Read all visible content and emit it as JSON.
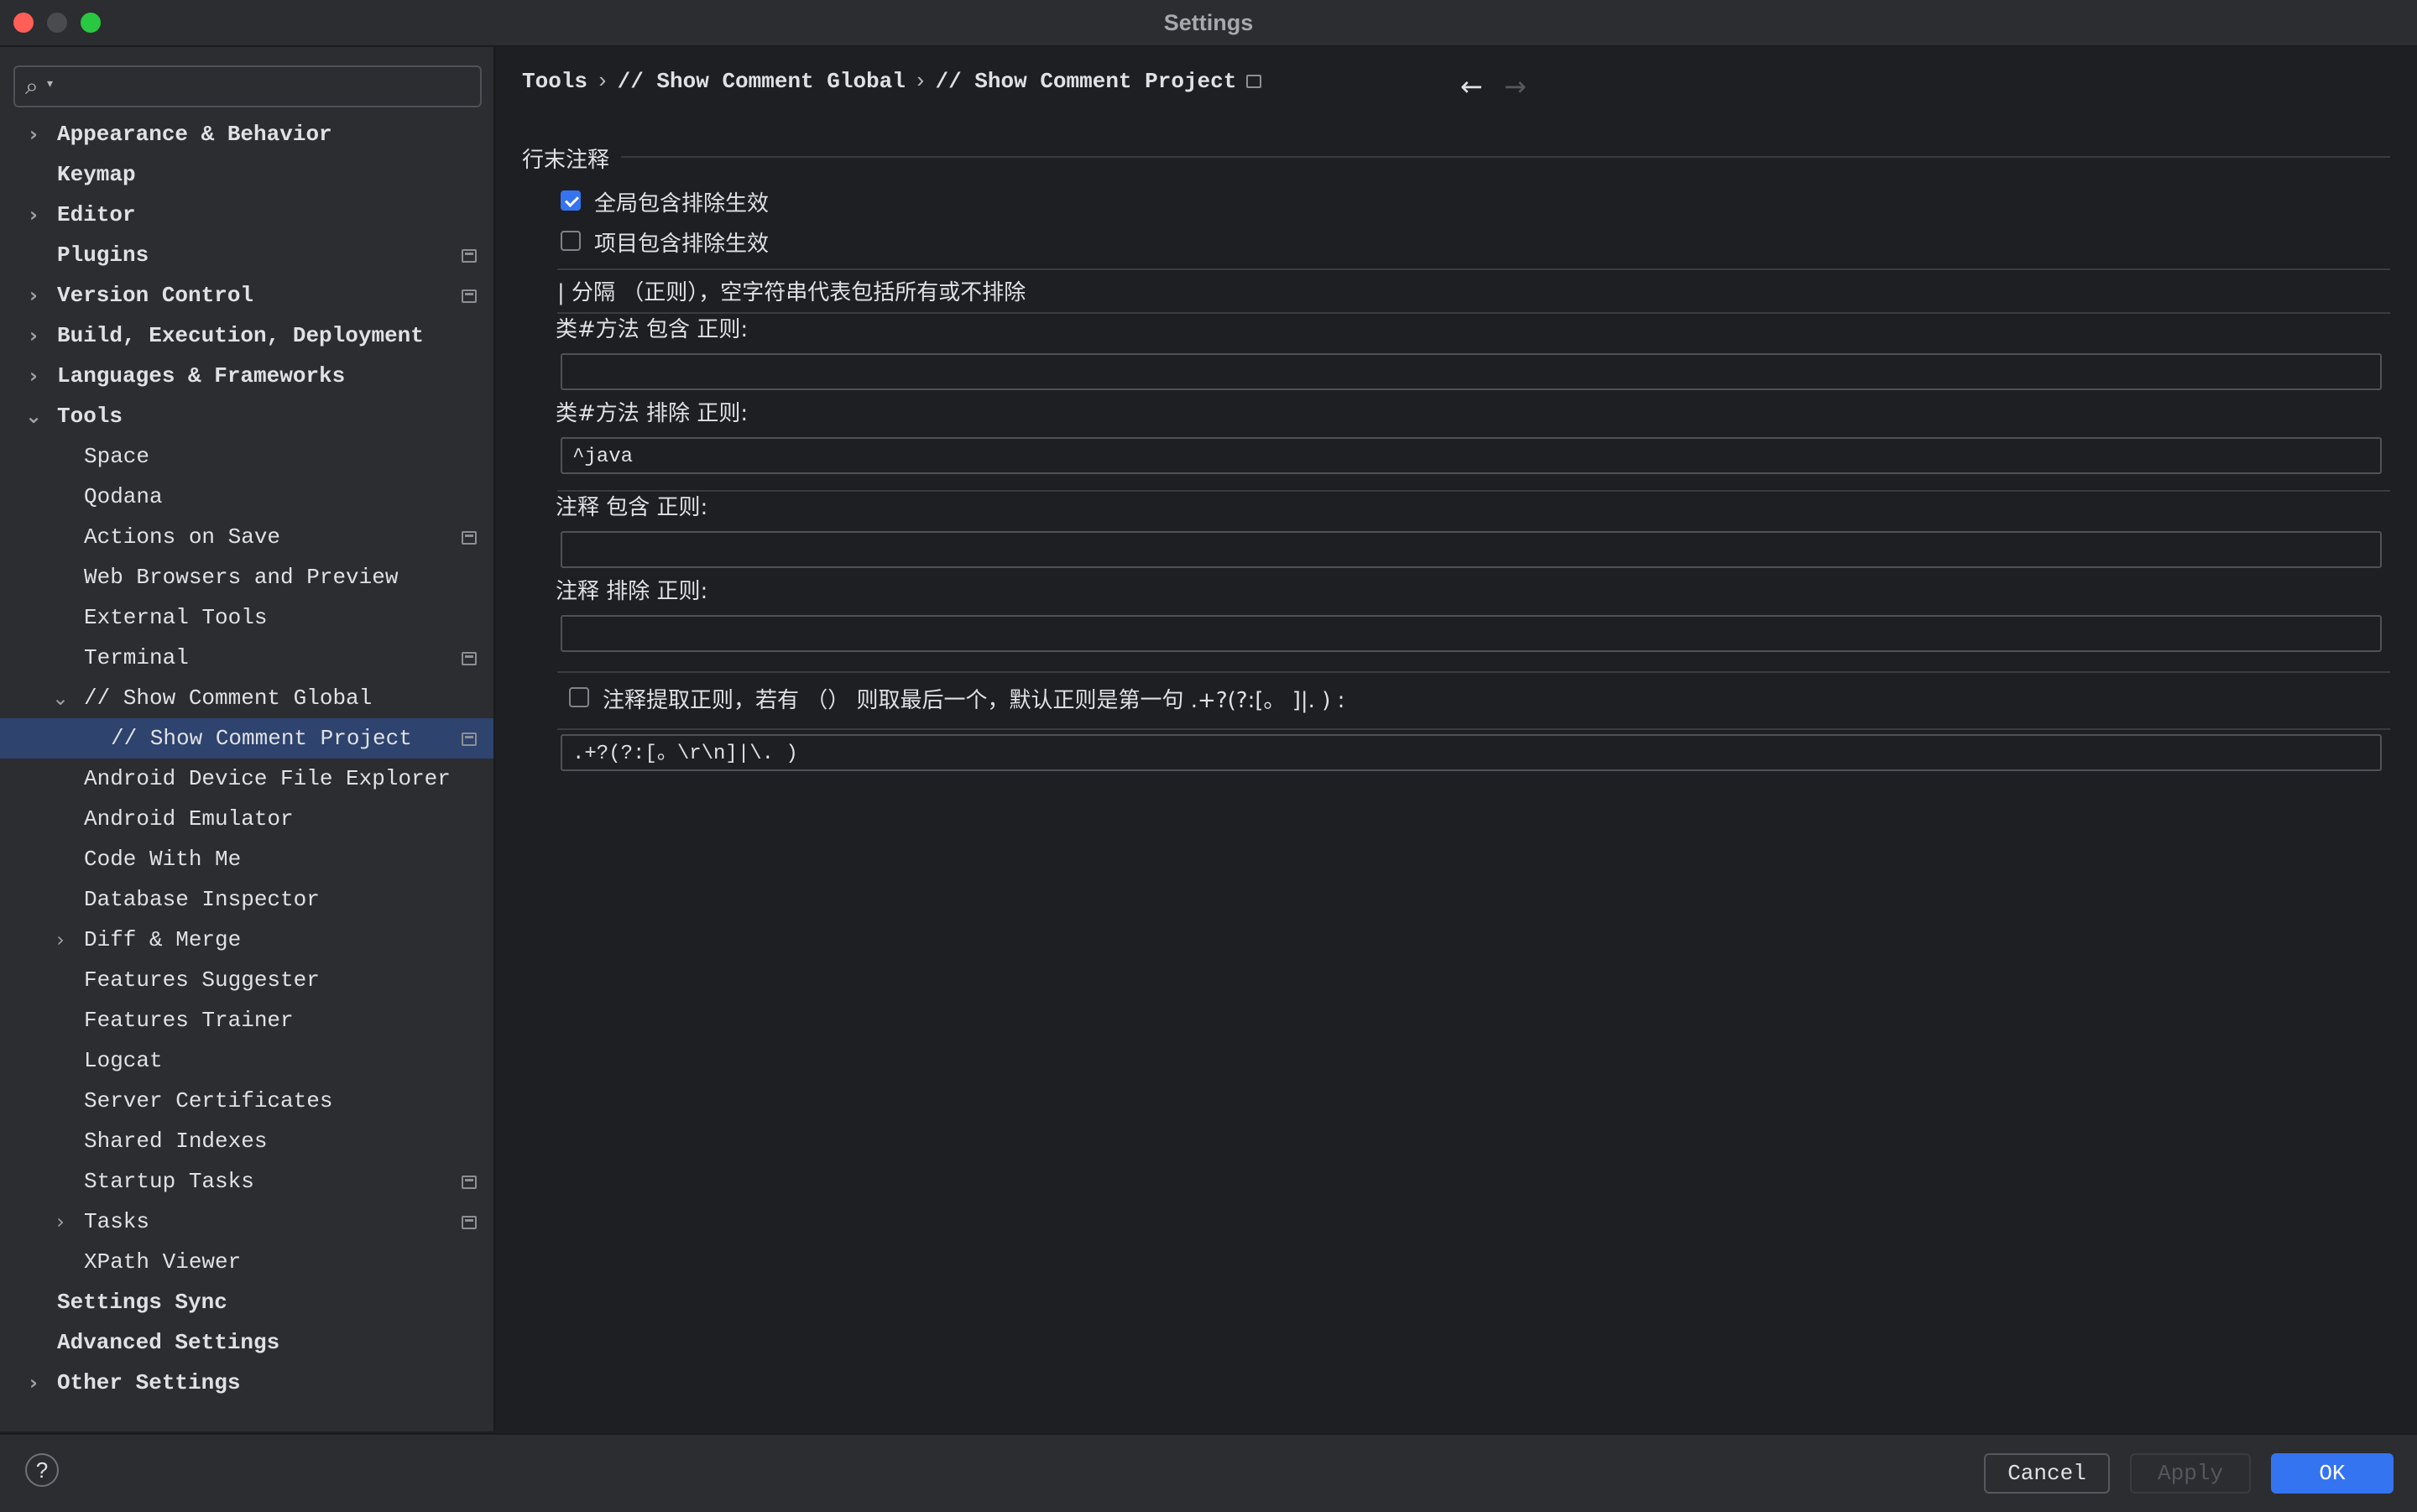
{
  "window": {
    "title": "Settings"
  },
  "search": {
    "placeholder": ""
  },
  "sidebar": {
    "items": [
      {
        "label": "Appearance & Behavior",
        "expander": "chevron-right"
      },
      {
        "label": "Keymap"
      },
      {
        "label": "Editor",
        "expander": "chevron-right"
      },
      {
        "label": "Plugins",
        "module_icon": true
      },
      {
        "label": "Version Control",
        "expander": "chevron-right",
        "module_icon": true
      },
      {
        "label": "Build, Execution, Deployment",
        "expander": "chevron-right"
      },
      {
        "label": "Languages & Frameworks",
        "expander": "chevron-right"
      },
      {
        "label": "Tools",
        "expander": "chevron-down"
      },
      {
        "label": "Space"
      },
      {
        "label": "Qodana"
      },
      {
        "label": "Actions on Save",
        "module_icon": true
      },
      {
        "label": "Web Browsers and Preview"
      },
      {
        "label": "External Tools"
      },
      {
        "label": "Terminal",
        "module_icon": true
      },
      {
        "label": "// Show Comment Global",
        "expander": "chevron-down"
      },
      {
        "label": "// Show Comment Project",
        "selected": true,
        "module_icon": true
      },
      {
        "label": "Android Device File Explorer"
      },
      {
        "label": "Android Emulator"
      },
      {
        "label": "Code With Me"
      },
      {
        "label": "Database Inspector"
      },
      {
        "label": "Diff & Merge",
        "expander": "chevron-right"
      },
      {
        "label": "Features Suggester"
      },
      {
        "label": "Features Trainer"
      },
      {
        "label": "Logcat"
      },
      {
        "label": "Server Certificates"
      },
      {
        "label": "Shared Indexes"
      },
      {
        "label": "Startup Tasks",
        "module_icon": true
      },
      {
        "label": "Tasks",
        "expander": "chevron-right",
        "module_icon": true
      },
      {
        "label": "XPath Viewer"
      },
      {
        "label": "Settings Sync"
      },
      {
        "label": "Advanced Settings"
      },
      {
        "label": "Other Settings",
        "expander": "chevron-right"
      }
    ]
  },
  "breadcrumb": {
    "items": [
      "Tools",
      "// Show Comment Global",
      "// Show Comment Project"
    ],
    "separator": "›"
  },
  "main": {
    "section_title": "行末注释",
    "global_checkbox": {
      "label": "全局包含排除生效",
      "checked": true
    },
    "project_checkbox": {
      "label": "项目包含排除生效",
      "checked": false
    },
    "hint": "| 分隔 （正则），空字符串代表包括所有或不排除",
    "class_method_include": {
      "label": "类#方法 包含 正则:",
      "value": ""
    },
    "class_method_exclude": {
      "label": "类#方法 排除 正则:",
      "value": "^java"
    },
    "comment_include": {
      "label": "注释 包含 正则:",
      "value": ""
    },
    "comment_exclude": {
      "label": "注释 排除 正则:",
      "value": ""
    },
    "extract_checkbox": {
      "label": "注释提取正则，若有 （） 则取最后一个，默认正则是第一句 .+?(?:[。  ]|. ) :",
      "checked": false
    },
    "extract_value": ".+?(?:[。\\r\\n]|\\. )"
  },
  "footer": {
    "help": "?",
    "cancel": "Cancel",
    "apply": "Apply",
    "ok": "OK"
  },
  "colors": {
    "accent": "#3574f0",
    "selection": "#2e436e",
    "background": "#1e1f22",
    "panel": "#2b2d30"
  }
}
